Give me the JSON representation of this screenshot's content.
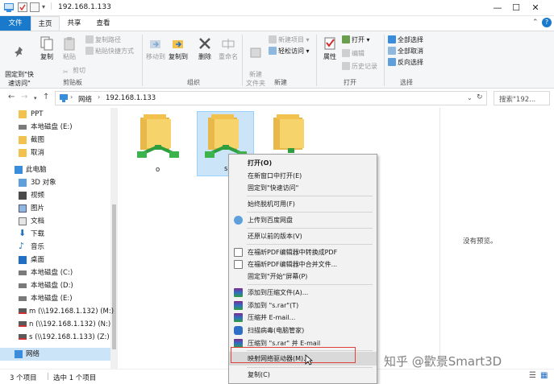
{
  "window": {
    "title": "192.168.1.133",
    "min_icon": "minimize-icon",
    "max_icon": "maximize-icon",
    "close_icon": "close-icon"
  },
  "tabs": {
    "file": "文件",
    "home": "主页",
    "share": "共享",
    "view": "查看"
  },
  "ribbon": {
    "clipboard": {
      "pin": "固定到\"快\n速访问\"",
      "copy": "复制",
      "paste": "粘贴",
      "copy_path": "复制路径",
      "paste_shortcut": "粘贴快捷方式",
      "cut": "剪切",
      "group": "剪贴板"
    },
    "organize": {
      "move_to": "移动到",
      "copy_to": "复制到",
      "delete": "删除",
      "rename": "重命名",
      "group": "组织"
    },
    "new": {
      "new_folder": "新建\n文件夹",
      "new_item": "新建项目",
      "easy_access": "轻松访问",
      "group": "新建"
    },
    "open": {
      "properties": "属性",
      "open": "打开",
      "edit": "编辑",
      "history": "历史记录",
      "group": "打开"
    },
    "select": {
      "select_all": "全部选择",
      "select_none": "全部取消",
      "invert": "反向选择",
      "group": "选择"
    }
  },
  "address": {
    "path_root": "网络",
    "path_leaf": "192.168.1.133",
    "search_placeholder": "搜索\"192...",
    "refresh_icon": "refresh-icon"
  },
  "nav": [
    {
      "label": "PPT",
      "icon": "folder-icon"
    },
    {
      "label": "本地磁盘 (E:)",
      "icon": "drive-icon"
    },
    {
      "label": "截图",
      "icon": "folder-icon"
    },
    {
      "label": "取消",
      "icon": "folder-icon"
    },
    {
      "label": "此电脑",
      "icon": "computer-icon"
    },
    {
      "label": "3D 对象",
      "icon": "3d-objects-icon"
    },
    {
      "label": "视频",
      "icon": "video-icon"
    },
    {
      "label": "图片",
      "icon": "pictures-icon"
    },
    {
      "label": "文档",
      "icon": "documents-icon"
    },
    {
      "label": "下载",
      "icon": "download-icon"
    },
    {
      "label": "音乐",
      "icon": "music-icon"
    },
    {
      "label": "桌面",
      "icon": "desktop-icon"
    },
    {
      "label": "本地磁盘 (C:)",
      "icon": "drive-icon"
    },
    {
      "label": "本地磁盘 (D:)",
      "icon": "drive-icon"
    },
    {
      "label": "本地磁盘 (E:)",
      "icon": "drive-icon"
    },
    {
      "label": "m (\\\\192.168.1.132) (M:)",
      "icon": "network-drive-icon"
    },
    {
      "label": "n (\\\\192.168.1.132) (N:)",
      "icon": "network-drive-icon"
    },
    {
      "label": "s (\\\\192.168.1.133) (Z:)",
      "icon": "network-drive-icon"
    },
    {
      "label": "网络",
      "icon": "network-icon"
    }
  ],
  "files": [
    {
      "name": "o"
    },
    {
      "name": "s"
    },
    {
      "name": ""
    }
  ],
  "preview": {
    "empty_text": "没有预览。"
  },
  "status": {
    "count": "3 个项目",
    "selected": "选中 1 个项目"
  },
  "context_menu": {
    "open": "打开(O)",
    "open_new_window": "在新窗口中打开(E)",
    "pin_quick": "固定到\"快速访问\"",
    "always_offline": "始终脱机可用(F)",
    "upload_baidu": "上传到百度网盘",
    "restore_versions": "还原以前的版本(V)",
    "foxit_convert": "在福昕PDF编辑器中转换成PDF",
    "foxit_merge": "在福昕PDF编辑器中合并文件...",
    "pin_start": "固定到\"开始\"屏幕(P)",
    "add_archive": "添加到压缩文件(A)...",
    "add_rar": "添加到 \"s.rar\"(T)",
    "compress_email": "压缩并 E-mail...",
    "scan_virus": "扫描病毒(电脑管家)",
    "compress_rar_email": "压缩到 \"s.rar\" 并 E-mail",
    "map_drive": "映射网络驱动器(M)...",
    "copy": "复制(C)"
  },
  "watermark": "知乎 @歡景Smart3D"
}
